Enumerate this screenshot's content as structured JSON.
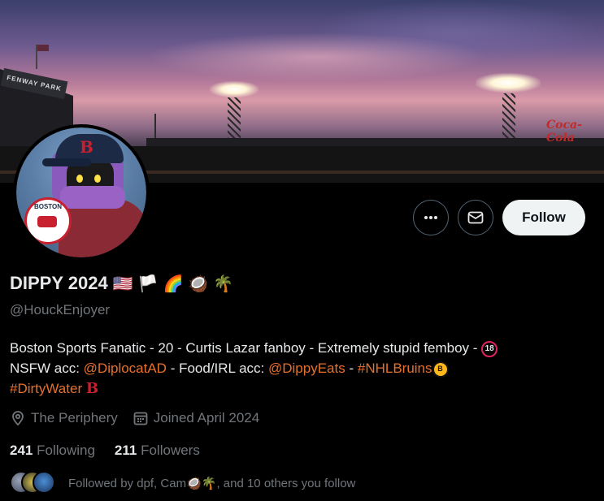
{
  "banner": {
    "park_sign": "FENWAY PARK",
    "ad_sign": "Coca-Cola"
  },
  "profile": {
    "display_name": "DIPPY 2024",
    "name_emojis": [
      "🇺🇸",
      "🏳️",
      "🌈",
      "🥥",
      "🌴"
    ],
    "handle": "@HouckEnjoyer",
    "avatar_cap_letter": "B",
    "avatar_logo_text": "BOSTON"
  },
  "actions": {
    "more_icon": "more-horizontal-icon",
    "message_icon": "envelope-icon",
    "follow_label": "Follow"
  },
  "bio": {
    "line1_text": "Boston Sports Fanatic - 20 - Curtis Lazar fanboy - Extremely stupid femboy - ",
    "age_badge": "18",
    "line2_prefix": "NSFW acc: ",
    "nsfw_link": "@DiplocatAD",
    "line2_mid": " - Food/IRL acc: ",
    "food_link": "@DippyEats",
    "line2_sep": " - ",
    "hashtag1": "#NHLBruins",
    "bruins_badge": "B",
    "hashtag2": "#DirtyWater",
    "sox_letter": "B"
  },
  "meta": {
    "location": "The Periphery",
    "joined": "Joined April 2024"
  },
  "counts": {
    "following_num": "241",
    "following_label": "Following",
    "followers_num": "211",
    "followers_label": "Followers"
  },
  "followed_by": {
    "text_prefix": "Followed by dpf, Cam",
    "emojis": "🥥🌴",
    "text_suffix": ", and 10 others you follow"
  },
  "colors": {
    "link": "#e8702a",
    "muted": "#71767b",
    "text": "#e7e9ea",
    "follow_bg": "#eff3f4"
  }
}
